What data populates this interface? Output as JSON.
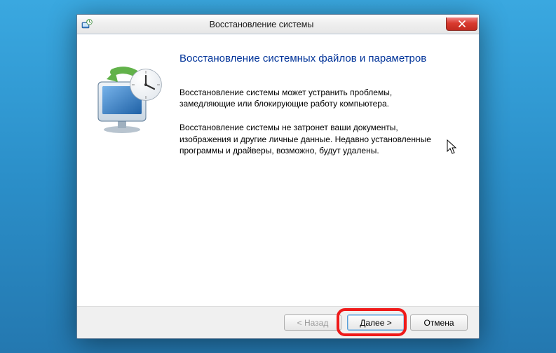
{
  "window": {
    "title": "Восстановление системы"
  },
  "heading": "Восстановление системных файлов и параметров",
  "paragraph1": "Восстановление системы может устранить проблемы, замедляющие или блокирующие работу компьютера.",
  "paragraph2": "Восстановление системы не затронет ваши документы, изображения и другие личные данные. Недавно установленные программы и драйверы, возможно, будут удалены.",
  "buttons": {
    "back": "< Назад",
    "next": "Далее >",
    "cancel": "Отмена"
  },
  "icons": {
    "app": "system-restore-icon",
    "close": "close-icon",
    "illustration": "monitor-clock-restore-illustration",
    "cursor": "mouse-cursor"
  }
}
